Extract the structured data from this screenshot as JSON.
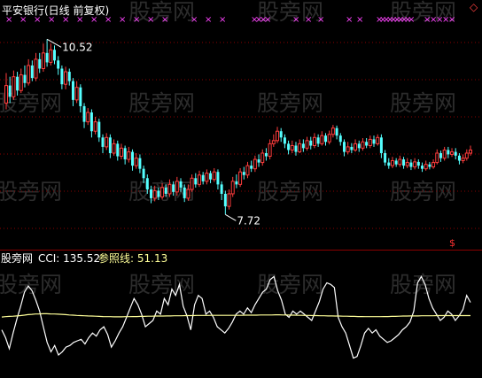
{
  "title": "平安银行(日线 前复权)",
  "watermark": "股旁网",
  "colors": {
    "background": "#000000",
    "up_candle": "#ff3c3c",
    "down_candle": "#54ffff",
    "title": "#ffffff",
    "cci_line": "#ffffff",
    "reference_line": "#ffff99",
    "signal_marker": "#ff44ff",
    "grid": "#8b0000",
    "price_label": "#ffffff"
  },
  "chart_data": [
    {
      "type": "candlestick",
      "title": "平安银行(日线 前复权)",
      "high_label": "10.52",
      "low_label": "7.72",
      "ylim": [
        7.3,
        10.75
      ],
      "grid": "dotted horizontal",
      "signal_markers": "row of × marks along top edge",
      "candles": [
        [
          9.5,
          9.78,
          9.98,
          9.4
        ],
        [
          9.78,
          9.6,
          9.92,
          9.5
        ],
        [
          9.6,
          9.92,
          10.02,
          9.55
        ],
        [
          9.92,
          9.7,
          10.0,
          9.62
        ],
        [
          9.7,
          9.95,
          10.05,
          9.66
        ],
        [
          9.95,
          9.82,
          10.1,
          9.75
        ],
        [
          9.82,
          10.1,
          10.2,
          9.78
        ],
        [
          10.1,
          9.9,
          10.18,
          9.85
        ],
        [
          9.9,
          10.2,
          10.3,
          9.85
        ],
        [
          10.2,
          10.05,
          10.3,
          9.98
        ],
        [
          10.05,
          10.3,
          10.45,
          10.0
        ],
        [
          10.3,
          10.15,
          10.52,
          10.08
        ],
        [
          10.15,
          10.35,
          10.45,
          10.1
        ],
        [
          10.35,
          10.18,
          10.42,
          10.12
        ],
        [
          10.18,
          10.05,
          10.25,
          9.95
        ],
        [
          10.05,
          9.8,
          10.1,
          9.72
        ],
        [
          9.8,
          10.0,
          10.08,
          9.72
        ],
        [
          10.0,
          9.85,
          10.05,
          9.78
        ],
        [
          9.85,
          9.55,
          9.9,
          9.45
        ],
        [
          9.55,
          9.75,
          9.85,
          9.5
        ],
        [
          9.75,
          9.45,
          9.8,
          9.35
        ],
        [
          9.45,
          9.2,
          9.5,
          9.1
        ],
        [
          9.2,
          9.35,
          9.42,
          9.15
        ],
        [
          9.35,
          9.05,
          9.4,
          8.95
        ],
        [
          9.05,
          9.2,
          9.28,
          9.0
        ],
        [
          9.2,
          8.95,
          9.25,
          8.88
        ],
        [
          8.95,
          8.8,
          9.0,
          8.7
        ],
        [
          8.8,
          8.95,
          9.02,
          8.75
        ],
        [
          8.95,
          8.7,
          9.0,
          8.62
        ],
        [
          8.7,
          8.85,
          8.92,
          8.66
        ],
        [
          8.85,
          8.65,
          8.9,
          8.58
        ],
        [
          8.65,
          8.78,
          8.85,
          8.6
        ],
        [
          8.78,
          8.6,
          8.82,
          8.52
        ],
        [
          8.6,
          8.72,
          8.8,
          8.55
        ],
        [
          8.72,
          8.5,
          8.76,
          8.42
        ],
        [
          8.5,
          8.62,
          8.7,
          8.45
        ],
        [
          8.62,
          8.45,
          8.68,
          8.38
        ],
        [
          8.45,
          8.3,
          8.5,
          8.22
        ],
        [
          8.3,
          8.12,
          8.36,
          8.05
        ],
        [
          8.12,
          7.98,
          8.18,
          7.9
        ],
        [
          7.98,
          8.1,
          8.18,
          7.93
        ],
        [
          8.1,
          8.0,
          8.15,
          7.95
        ],
        [
          8.0,
          8.15,
          8.22,
          7.96
        ],
        [
          8.15,
          8.05,
          8.2,
          8.0
        ],
        [
          8.05,
          8.2,
          8.28,
          8.0
        ],
        [
          8.2,
          8.08,
          8.25,
          8.02
        ],
        [
          8.08,
          8.25,
          8.32,
          8.02
        ],
        [
          8.25,
          8.15,
          8.3,
          8.08
        ],
        [
          8.15,
          7.98,
          8.2,
          7.92
        ],
        [
          7.98,
          8.12,
          8.2,
          7.94
        ],
        [
          8.12,
          8.3,
          8.36,
          8.08
        ],
        [
          8.3,
          8.2,
          8.38,
          8.15
        ],
        [
          8.2,
          8.35,
          8.42,
          8.16
        ],
        [
          8.35,
          8.25,
          8.4,
          8.2
        ],
        [
          8.25,
          8.38,
          8.44,
          8.2
        ],
        [
          8.38,
          8.28,
          8.42,
          8.22
        ],
        [
          8.28,
          8.4,
          8.46,
          8.24
        ],
        [
          8.4,
          8.2,
          8.44,
          8.12
        ],
        [
          8.2,
          8.05,
          8.25,
          7.95
        ],
        [
          8.05,
          7.85,
          8.1,
          7.72
        ],
        [
          7.85,
          8.05,
          8.12,
          7.8
        ],
        [
          8.05,
          8.25,
          8.32,
          8.0
        ],
        [
          8.25,
          8.2,
          8.36,
          8.14
        ],
        [
          8.2,
          8.4,
          8.46,
          8.16
        ],
        [
          8.4,
          8.35,
          8.48,
          8.28
        ],
        [
          8.35,
          8.5,
          8.56,
          8.3
        ],
        [
          8.5,
          8.45,
          8.58,
          8.4
        ],
        [
          8.45,
          8.6,
          8.66,
          8.4
        ],
        [
          8.6,
          8.55,
          8.68,
          8.48
        ],
        [
          8.55,
          8.7,
          8.76,
          8.5
        ],
        [
          8.7,
          8.65,
          8.78,
          8.58
        ],
        [
          8.65,
          8.85,
          8.92,
          8.6
        ],
        [
          8.85,
          8.9,
          9.0,
          8.8
        ],
        [
          8.9,
          9.05,
          9.12,
          8.86
        ],
        [
          9.05,
          8.95,
          9.1,
          8.88
        ],
        [
          8.95,
          8.85,
          9.0,
          8.78
        ],
        [
          8.85,
          8.75,
          8.9,
          8.68
        ],
        [
          8.75,
          8.82,
          8.9,
          8.7
        ],
        [
          8.82,
          8.72,
          8.88,
          8.66
        ],
        [
          8.72,
          8.85,
          8.92,
          8.7
        ],
        [
          8.85,
          8.78,
          8.92,
          8.72
        ],
        [
          8.78,
          8.9,
          8.96,
          8.74
        ],
        [
          8.9,
          8.82,
          8.96,
          8.76
        ],
        [
          8.82,
          8.95,
          9.02,
          8.78
        ],
        [
          8.95,
          8.85,
          9.0,
          8.8
        ],
        [
          8.85,
          8.98,
          9.05,
          8.82
        ],
        [
          8.98,
          8.88,
          9.02,
          8.82
        ],
        [
          8.88,
          9.0,
          9.06,
          8.84
        ],
        [
          9.0,
          9.1,
          9.15,
          8.95
        ],
        [
          9.1,
          8.98,
          9.14,
          8.92
        ],
        [
          8.98,
          8.88,
          9.02,
          8.82
        ],
        [
          8.88,
          8.72,
          8.92,
          8.65
        ],
        [
          8.72,
          8.8,
          8.88,
          8.68
        ],
        [
          8.8,
          8.75,
          8.86,
          8.7
        ],
        [
          8.75,
          8.85,
          8.92,
          8.72
        ],
        [
          8.85,
          8.78,
          8.9,
          8.72
        ],
        [
          8.78,
          8.88,
          8.94,
          8.74
        ],
        [
          8.88,
          8.82,
          8.94,
          8.78
        ],
        [
          8.82,
          8.92,
          8.98,
          8.78
        ],
        [
          8.92,
          8.85,
          8.98,
          8.8
        ],
        [
          8.85,
          8.95,
          9.0,
          8.82
        ],
        [
          8.95,
          8.7,
          9.0,
          8.62
        ],
        [
          8.7,
          8.55,
          8.75,
          8.5
        ],
        [
          8.55,
          8.5,
          8.62,
          8.45
        ],
        [
          8.5,
          8.58,
          8.64,
          8.46
        ],
        [
          8.58,
          8.52,
          8.62,
          8.48
        ],
        [
          8.52,
          8.6,
          8.66,
          8.48
        ],
        [
          8.6,
          8.5,
          8.64,
          8.45
        ],
        [
          8.5,
          8.55,
          8.62,
          8.46
        ],
        [
          8.55,
          8.48,
          8.6,
          8.43
        ],
        [
          8.48,
          8.56,
          8.62,
          8.44
        ],
        [
          8.56,
          8.5,
          8.6,
          8.45
        ],
        [
          8.5,
          8.45,
          8.55,
          8.4
        ],
        [
          8.45,
          8.52,
          8.58,
          8.42
        ],
        [
          8.52,
          8.48,
          8.56,
          8.44
        ],
        [
          8.48,
          8.55,
          8.6,
          8.45
        ],
        [
          8.55,
          8.7,
          8.76,
          8.52
        ],
        [
          8.7,
          8.62,
          8.74,
          8.56
        ],
        [
          8.62,
          8.75,
          8.8,
          8.58
        ],
        [
          8.75,
          8.68,
          8.8,
          8.62
        ],
        [
          8.68,
          8.72,
          8.78,
          8.64
        ],
        [
          8.72,
          8.66,
          8.78,
          8.6
        ],
        [
          8.66,
          8.58,
          8.7,
          8.52
        ],
        [
          8.58,
          8.62,
          8.68,
          8.54
        ],
        [
          8.62,
          8.7,
          8.76,
          8.58
        ],
        [
          8.7,
          8.75,
          8.82,
          8.66
        ]
      ]
    },
    {
      "type": "line",
      "indicator": "CCI",
      "cci_label": "CCI: 135.52",
      "ref_label": "参照线: 51.13",
      "watermark_label": "股旁网",
      "ylim": [
        -330,
        370
      ],
      "series": [
        {
          "name": "CCI",
          "values": [
            -40,
            -90,
            -160,
            -60,
            30,
            110,
            200,
            240,
            210,
            150,
            80,
            -20,
            -120,
            -180,
            -140,
            -200,
            -180,
            -150,
            -140,
            -120,
            -110,
            -100,
            -130,
            -90,
            -60,
            -80,
            -40,
            -20,
            -70,
            -150,
            -110,
            -60,
            -20,
            40,
            100,
            160,
            120,
            60,
            -20,
            0,
            20,
            80,
            60,
            160,
            120,
            220,
            180,
            250,
            110,
            50,
            -40,
            120,
            180,
            160,
            60,
            80,
            40,
            -20,
            -40,
            -60,
            -30,
            10,
            60,
            80,
            60,
            100,
            70,
            120,
            160,
            200,
            220,
            280,
            300,
            210,
            150,
            60,
            40,
            80,
            60,
            80,
            60,
            40,
            20,
            80,
            140,
            220,
            260,
            250,
            230,
            40,
            -20,
            -60,
            -140,
            -220,
            -210,
            -140,
            -60,
            -30,
            -60,
            -40,
            -80,
            -100,
            -120,
            -110,
            -90,
            -70,
            -40,
            -20,
            10,
            80,
            260,
            300,
            250,
            160,
            100,
            60,
            20,
            40,
            80,
            60,
            20,
            50,
            90,
            180,
            135
          ]
        },
        {
          "name": "参照线",
          "values": [
            42,
            44,
            46,
            47,
            49,
            51,
            54,
            57,
            59,
            61,
            62,
            63,
            63,
            62,
            61,
            60,
            59,
            57,
            55,
            54,
            52,
            51,
            50,
            49,
            48,
            47,
            46,
            45,
            44,
            44,
            43,
            43,
            43,
            44,
            44,
            45,
            45,
            46,
            46,
            47,
            47,
            48,
            48,
            48,
            49,
            49,
            50,
            50,
            50,
            51,
            51,
            51,
            52,
            52,
            52,
            52,
            53,
            53,
            53,
            53,
            53,
            53,
            53,
            53,
            53,
            54,
            54,
            54,
            54,
            55,
            55,
            55,
            55,
            56,
            56,
            55,
            55,
            54,
            54,
            53,
            53,
            52,
            52,
            51,
            51,
            50,
            50,
            49,
            49,
            48,
            48,
            47,
            47,
            46,
            46,
            45,
            45,
            44,
            44,
            44,
            44,
            44,
            45,
            45,
            46,
            46,
            47,
            48,
            48,
            49,
            49,
            49,
            50,
            50,
            50,
            50,
            51,
            51,
            51,
            51,
            51,
            51,
            51,
            51,
            51,
            51
          ]
        }
      ]
    }
  ]
}
